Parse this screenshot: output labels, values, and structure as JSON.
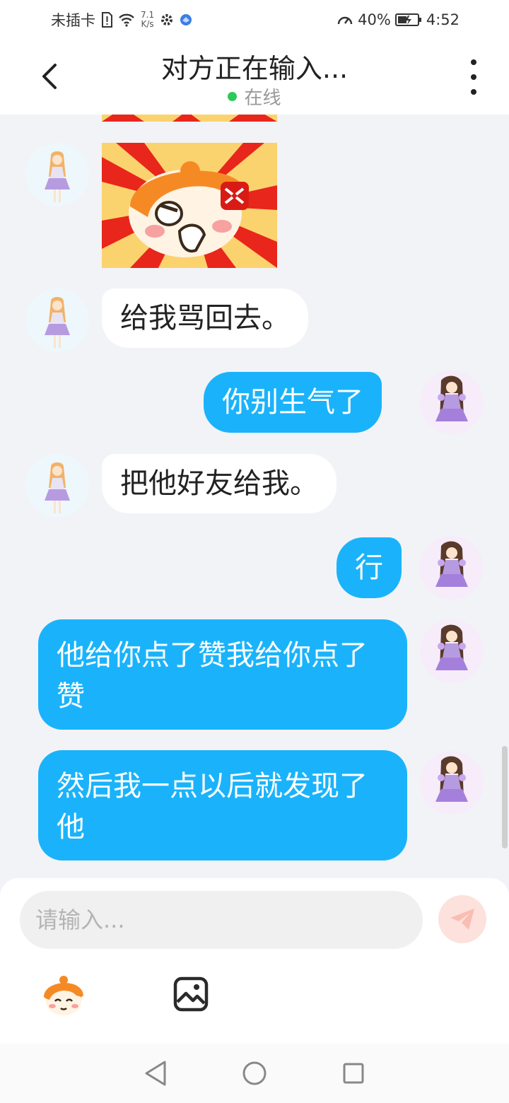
{
  "status_bar": {
    "carrier": "未插卡",
    "net_speed_value": "7.1",
    "net_speed_unit": "K/s",
    "battery_percent": "40%",
    "time": "4:52"
  },
  "header": {
    "title": "对方正在输入...",
    "status": "在线"
  },
  "messages": [
    {
      "side": "left",
      "type": "sticker",
      "content": "angry-face-sticker"
    },
    {
      "side": "left",
      "type": "text",
      "text": "给我骂回去。"
    },
    {
      "side": "right",
      "type": "text",
      "text": "你别生气了"
    },
    {
      "side": "left",
      "type": "text",
      "text": "把他好友给我。"
    },
    {
      "side": "right",
      "type": "text",
      "text": "行"
    },
    {
      "side": "right",
      "type": "text",
      "text": "他给你点了赞我给你点了赞"
    },
    {
      "side": "right",
      "type": "text",
      "text": "然后我一点以后就发现了他"
    }
  ],
  "input": {
    "placeholder": "请输入..."
  },
  "toolbar": {
    "emoji_icon": "emoji-sticker-icon",
    "image_icon": "image-icon"
  },
  "nav": {
    "back": "triangle-back-icon",
    "home": "circle-home-icon",
    "recent": "square-recent-icon"
  },
  "colors": {
    "accent": "#1ab3fb",
    "online": "#2bc957",
    "send_button_bg": "#fde1dc",
    "send_button_icon": "#f9bdb4"
  }
}
